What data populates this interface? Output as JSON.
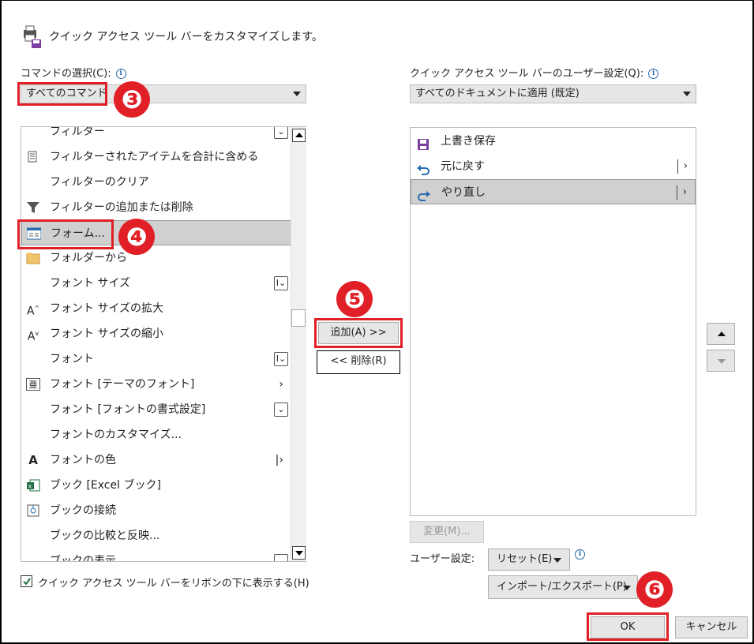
{
  "dialog": {
    "title": "クイック アクセス ツール バーをカスタマイズします。"
  },
  "left": {
    "choose_label": "コマンドの選択(C):",
    "dropdown_value": "すべてのコマンド",
    "items": [
      {
        "label": "フィルター",
        "icon": "none",
        "right": "expand-icon"
      },
      {
        "label": "フィルターされたアイテムを合計に含める",
        "icon": "filter-items-icon",
        "right": ""
      },
      {
        "label": "フィルターのクリア",
        "icon": "none",
        "right": ""
      },
      {
        "label": "フィルターの追加または削除",
        "icon": "funnel-icon",
        "right": ""
      },
      {
        "label": "フォーム...",
        "icon": "form-icon",
        "right": ""
      },
      {
        "label": "フォルダーから",
        "icon": "folder-icon",
        "right": ""
      },
      {
        "label": "フォント サイズ",
        "icon": "none",
        "right": "text-cursor-icon"
      },
      {
        "label": "フォント サイズの拡大",
        "icon": "font-grow-icon",
        "right": ""
      },
      {
        "label": "フォント サイズの縮小",
        "icon": "font-shrink-icon",
        "right": ""
      },
      {
        "label": "フォント",
        "icon": "none",
        "right": "text-cursor-icon"
      },
      {
        "label": "フォント [テーマのフォント]",
        "icon": "theme-font-icon",
        "right": "submenu-arrow"
      },
      {
        "label": "フォント [フォントの書式設定]",
        "icon": "none",
        "right": "expand-icon"
      },
      {
        "label": "フォントのカスタマイズ...",
        "icon": "none",
        "right": ""
      },
      {
        "label": "フォントの色",
        "icon": "font-color-icon",
        "right": "split-arrow"
      },
      {
        "label": "ブック [Excel ブック]",
        "icon": "excel-icon",
        "right": ""
      },
      {
        "label": "ブックの接続",
        "icon": "connection-icon",
        "right": ""
      },
      {
        "label": "ブックの比較と反映...",
        "icon": "none",
        "right": ""
      },
      {
        "label": "ブックの表示",
        "icon": "none",
        "right": "expand-icon"
      }
    ]
  },
  "middle": {
    "add_label": "追加(A) >>",
    "remove_label": "<< 削除(R)"
  },
  "right": {
    "customize_label": "クイック アクセス ツール バーのユーザー設定(Q):",
    "dropdown_value": "すべてのドキュメントに適用 (既定)",
    "items": [
      {
        "label": "上書き保存",
        "icon": "save-icon"
      },
      {
        "label": "元に戻す",
        "icon": "undo-icon"
      },
      {
        "label": "やり直し",
        "icon": "redo-icon"
      }
    ],
    "modify_label": "変更(M)...",
    "user_setting_label": "ユーザー設定:",
    "reset_label": "リセット(E)",
    "import_export_label": "インポート/エクスポート(P)"
  },
  "footer": {
    "show_below_label": "クイック アクセス ツール バーをリボンの下に表示する(H)",
    "show_below_checked": true,
    "ok_label": "OK",
    "cancel_label": "キャンセル"
  },
  "annotations": {
    "step3": "❸",
    "step4": "❹",
    "step5": "❺",
    "step6": "❻",
    "color": "#e01f26"
  }
}
